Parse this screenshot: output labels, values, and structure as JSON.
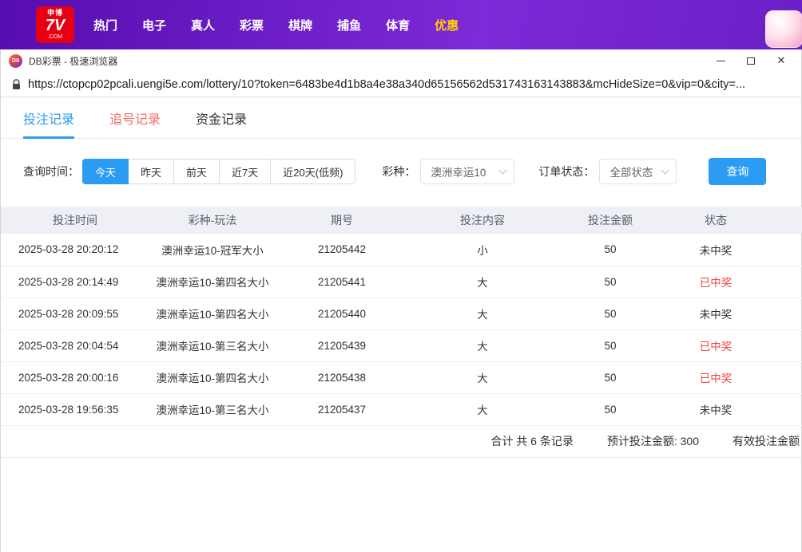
{
  "site_header": {
    "logo": {
      "top": "申博",
      "main": "7V",
      "sub": ".COM"
    },
    "nav_items": [
      {
        "label": "热门"
      },
      {
        "label": "电子"
      },
      {
        "label": "真人"
      },
      {
        "label": "彩票"
      },
      {
        "label": "棋牌"
      },
      {
        "label": "捕鱼"
      },
      {
        "label": "体育"
      },
      {
        "label": "优惠"
      }
    ]
  },
  "browser": {
    "title": "DB彩票 - 极速浏览器",
    "app_icon_text": "D8",
    "url": "https://ctopcp02pcali.uengi5e.com/lottery/10?token=6483be4d1b8a4e38a340d65156562d531743163143883&mcHideSize=0&vip=0&city=...",
    "close_glyph": "✕"
  },
  "tabs": [
    {
      "label": "投注记录",
      "active": true
    },
    {
      "label": "追号记录",
      "active": false
    },
    {
      "label": "资金记录",
      "active": false
    }
  ],
  "filters": {
    "time_label": "查询时间：",
    "time_options": [
      {
        "label": "今天",
        "active": true
      },
      {
        "label": "昨天",
        "active": false
      },
      {
        "label": "前天",
        "active": false
      },
      {
        "label": "近7天",
        "active": false
      },
      {
        "label": "近20天(低频)",
        "active": false
      }
    ],
    "lottery_label": "彩种：",
    "lottery_selected": "澳洲幸运10",
    "order_status_label": "订单状态：",
    "order_status_selected": "全部状态",
    "query_button": "查询"
  },
  "table": {
    "headers": [
      "投注时间",
      "彩种-玩法",
      "期号",
      "投注内容",
      "投注金额",
      "状态"
    ],
    "rows": [
      [
        "2025-03-28 20:20:12",
        "澳洲幸运10-冠军大小",
        "21205442",
        "小",
        "50",
        "未中奖"
      ],
      [
        "2025-03-28 20:14:49",
        "澳洲幸运10-第四名大小",
        "21205441",
        "大",
        "50",
        "已中奖"
      ],
      [
        "2025-03-28 20:09:55",
        "澳洲幸运10-第四名大小",
        "21205440",
        "大",
        "50",
        "未中奖"
      ],
      [
        "2025-03-28 20:04:54",
        "澳洲幸运10-第三名大小",
        "21205439",
        "大",
        "50",
        "已中奖"
      ],
      [
        "2025-03-28 20:00:16",
        "澳洲幸运10-第四名大小",
        "21205438",
        "大",
        "50",
        "已中奖"
      ],
      [
        "2025-03-28 19:56:35",
        "澳洲幸运10-第三名大小",
        "21205437",
        "大",
        "50",
        "未中奖"
      ]
    ],
    "summary": {
      "total_records": "合计 共 6 条记录",
      "expected_amount": "预计投注金额: 300",
      "valid_amount": "有效投注金额"
    },
    "win_status_text": "已中奖"
  },
  "colors": {
    "accent_blue": "#2b9cf4",
    "win_red": "#f0413e",
    "tab_pink": "#f56c6c",
    "highlight_yellow": "#ffd100",
    "logo_red": "#e60012",
    "header_purple_start": "#560daf",
    "header_purple_end": "#7d2ad8",
    "table_header_bg": "#eef0f6"
  }
}
